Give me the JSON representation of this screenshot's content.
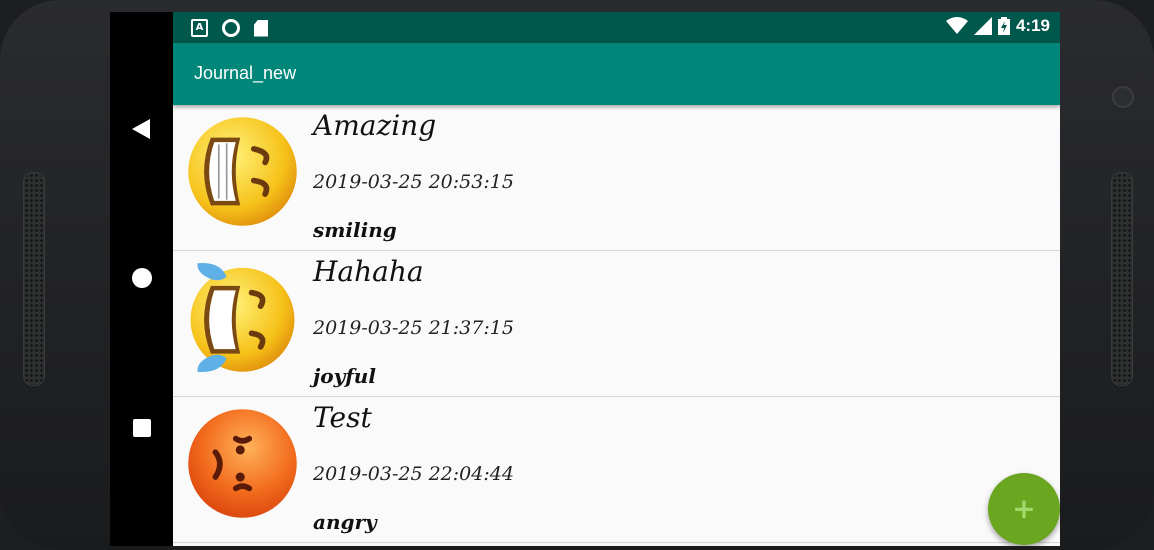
{
  "status_bar": {
    "time": "4:19",
    "left_icons": [
      "app-a-icon",
      "circle-notification-icon",
      "sd-card-icon"
    ],
    "right_icons": [
      "wifi-icon",
      "signal-icon",
      "battery-charging-icon"
    ]
  },
  "toolbar": {
    "title": "Journal_new"
  },
  "colors": {
    "status_bar": "#00574b",
    "toolbar": "#00877a",
    "fab": "#6aa620",
    "list_bg": "#fafafa"
  },
  "entries": [
    {
      "title": "Amazing",
      "date": "2019-03-25 20:53:15",
      "mood": "smiling",
      "icon": "grinning-face-icon"
    },
    {
      "title": "Hahaha",
      "date": "2019-03-25 21:37:15",
      "mood": "joyful",
      "icon": "tears-of-joy-face-icon"
    },
    {
      "title": "Test",
      "date": "2019-03-25 22:04:44",
      "mood": "angry",
      "icon": "angry-face-icon"
    }
  ],
  "fab": {
    "label": "+",
    "icon": "add-icon"
  },
  "nav": {
    "icons": [
      "back-icon",
      "home-icon",
      "recents-icon"
    ]
  }
}
